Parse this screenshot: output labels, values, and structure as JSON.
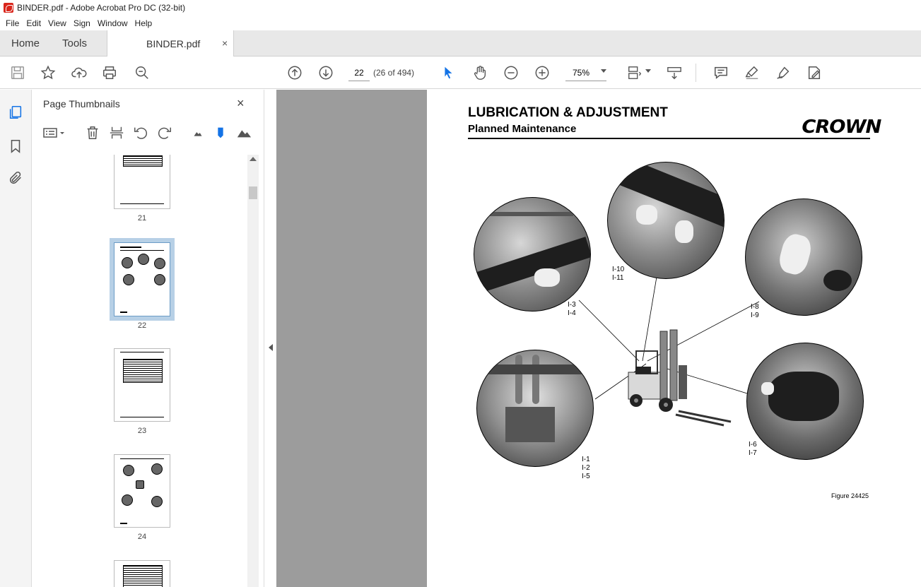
{
  "window": {
    "title": "BINDER.pdf - Adobe Acrobat Pro DC (32-bit)"
  },
  "menu": [
    "File",
    "Edit",
    "View",
    "Sign",
    "Window",
    "Help"
  ],
  "tabs": {
    "home": "Home",
    "tools": "Tools",
    "document": "BINDER.pdf",
    "close": "×"
  },
  "toolbar": {
    "page_current": "22",
    "page_count": "(26 of 494)",
    "zoom": "75%",
    "icons": [
      "save-icon",
      "star-icon",
      "upload-icon",
      "print-icon",
      "search-zoom-icon",
      "prev-page-icon",
      "next-page-icon",
      "select-cursor-icon",
      "hand-icon",
      "zoom-out-icon",
      "zoom-in-icon",
      "page-display-icon",
      "scroll-mode-icon",
      "comment-icon",
      "highlight-icon",
      "sign-icon",
      "fill-sign-icon"
    ]
  },
  "panel": {
    "title": "Page Thumbnails",
    "close": "×",
    "thumbnails": [
      {
        "label": "21"
      },
      {
        "label": "22",
        "selected": true
      },
      {
        "label": "23"
      },
      {
        "label": "24"
      }
    ]
  },
  "page": {
    "heading": "LUBRICATION & ADJUSTMENT",
    "subheading": "Planned Maintenance",
    "brand": "CROWN",
    "figure": "Figure 24425",
    "callouts": [
      {
        "lines": [
          "I-3",
          "I-4"
        ]
      },
      {
        "lines": [
          "I-10",
          "I-11"
        ]
      },
      {
        "lines": [
          "I-8",
          "I-9"
        ]
      },
      {
        "lines": [
          "I-1",
          "I-2",
          "I-5"
        ]
      },
      {
        "lines": [
          "I-6",
          "I-7"
        ]
      }
    ]
  }
}
